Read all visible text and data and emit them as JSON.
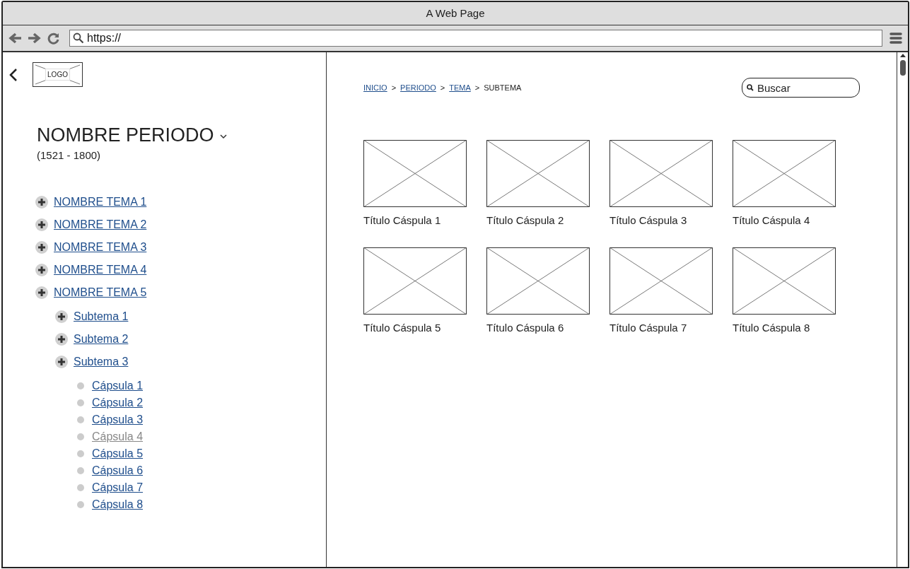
{
  "window": {
    "title": "A Web Page"
  },
  "address_bar": {
    "url": "https://"
  },
  "sidebar": {
    "logo": "LOGO",
    "period_title": "NOMBRE PERIODO",
    "period_range": "(1521 - 1800)",
    "tree": [
      {
        "label": "NOMBRE TEMA 1",
        "kind": "topic"
      },
      {
        "label": "NOMBRE TEMA 2",
        "kind": "topic"
      },
      {
        "label": "NOMBRE TEMA 3",
        "kind": "topic"
      },
      {
        "label": "NOMBRE TEMA 4",
        "kind": "topic"
      },
      {
        "label": "NOMBRE TEMA 5",
        "kind": "topic",
        "children": [
          {
            "label": "Subtema 1",
            "kind": "topic"
          },
          {
            "label": "Subtema 2",
            "kind": "topic"
          },
          {
            "label": "Subtema 3",
            "kind": "topic",
            "children": [
              {
                "label": "Cápsula 1",
                "kind": "capsule",
                "disabled": false
              },
              {
                "label": "Cápsula 2",
                "kind": "capsule",
                "disabled": false
              },
              {
                "label": "Cápsula 3",
                "kind": "capsule",
                "disabled": false
              },
              {
                "label": "Cápsula 4",
                "kind": "capsule",
                "disabled": true
              },
              {
                "label": "Cápsula 5",
                "kind": "capsule",
                "disabled": false
              },
              {
                "label": "Cápsula 6",
                "kind": "capsule",
                "disabled": false
              },
              {
                "label": "Cápsula 7",
                "kind": "capsule",
                "disabled": false
              },
              {
                "label": "Cápsula 8",
                "kind": "capsule",
                "disabled": false
              }
            ]
          }
        ]
      }
    ]
  },
  "breadcrumb": [
    {
      "label": "INICIO",
      "kind": "link"
    },
    {
      "label": "PERIODO",
      "kind": "link"
    },
    {
      "label": "TEMA",
      "kind": "link"
    },
    {
      "label": "SUBTEMA",
      "kind": "current"
    }
  ],
  "breadcrumb_separator": ">",
  "search": {
    "placeholder": "Buscar"
  },
  "cards": [
    {
      "title": "Título Cáspula 1"
    },
    {
      "title": "Título Cáspula 2"
    },
    {
      "title": "Título Cáspula 3"
    },
    {
      "title": "Título Cáspula 4"
    },
    {
      "title": "Título Cáspula 5"
    },
    {
      "title": "Título Cáspula 6"
    },
    {
      "title": "Título Cáspula 7"
    },
    {
      "title": "Título Cáspula 8"
    }
  ]
}
